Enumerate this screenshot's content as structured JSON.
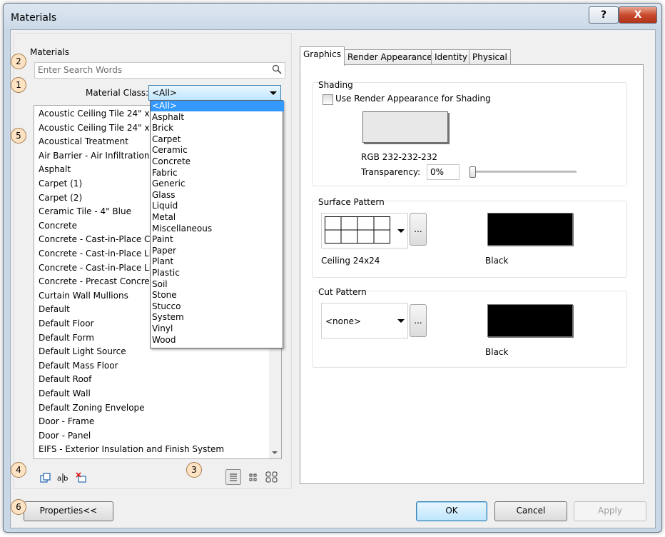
{
  "window": {
    "title": "Materials",
    "help_label": "?",
    "close_label": "X"
  },
  "left": {
    "group_label": "Materials",
    "search_placeholder": "Enter Search Words",
    "material_class_label": "Material Class:",
    "material_class_value": "<All>",
    "materials": [
      "Acoustic Ceiling Tile 24\" x 2",
      "Acoustic Ceiling Tile 24\" x 4",
      "Acoustical Treatment",
      "Air Barrier - Air Infiltration B",
      "Asphalt",
      "Carpet (1)",
      "Carpet (2)",
      "Ceramic Tile - 4\" Blue",
      "Concrete",
      "Concrete - Cast-in-Place Co",
      "Concrete - Cast-in-Place Lig",
      "Concrete - Cast-in-Place Lig",
      "Concrete - Precast Concrete",
      "Curtain Wall Mullions",
      "Default",
      "Default Floor",
      "Default Form",
      "Default Light Source",
      "Default Mass Floor",
      "Default Roof",
      "Default Wall",
      "Default Zoning Envelope",
      "Door - Frame",
      "Door - Panel",
      "EIFS - Exterior Insulation and Finish System"
    ],
    "class_options": [
      "<All>",
      "Asphalt",
      "Brick",
      "Carpet",
      "Ceramic",
      "Concrete",
      "Fabric",
      "Generic",
      "Glass",
      "Liquid",
      "Metal",
      "Miscellaneous",
      "Paint",
      "Paper",
      "Plant",
      "Plastic",
      "Soil",
      "Stone",
      "Stucco",
      "System",
      "Vinyl",
      "Wood"
    ],
    "callouts": {
      "c1": "1",
      "c2": "2",
      "c3": "3",
      "c4": "4",
      "c5": "5",
      "c6": "6"
    }
  },
  "tabs": [
    "Graphics",
    "Render Appearance",
    "Identity",
    "Physical"
  ],
  "graphics": {
    "shading_title": "Shading",
    "use_render_label": "Use Render Appearance for Shading",
    "rgb_label": "RGB 232-232-232",
    "shading_color": "#e8e8e8",
    "transparency_label": "Transparency:",
    "transparency_value": "0%",
    "transparency_level": 0,
    "surface_title": "Surface Pattern",
    "surface_pattern": "Ceiling 24x24",
    "surface_color_name": "Black",
    "surface_color": "#000000",
    "cut_title": "Cut Pattern",
    "cut_pattern": "<none>",
    "cut_color_name": "Black",
    "cut_color": "#000000",
    "ellipsis": "..."
  },
  "buttons": {
    "properties": "Properties<<",
    "ok": "OK",
    "cancel": "Cancel",
    "apply": "Apply"
  },
  "icons": [
    "search-icon",
    "duplicate-material-icon",
    "rename-material-icon",
    "delete-material-icon",
    "list-view-icon",
    "small-icons-view-icon",
    "large-icons-view-icon"
  ]
}
